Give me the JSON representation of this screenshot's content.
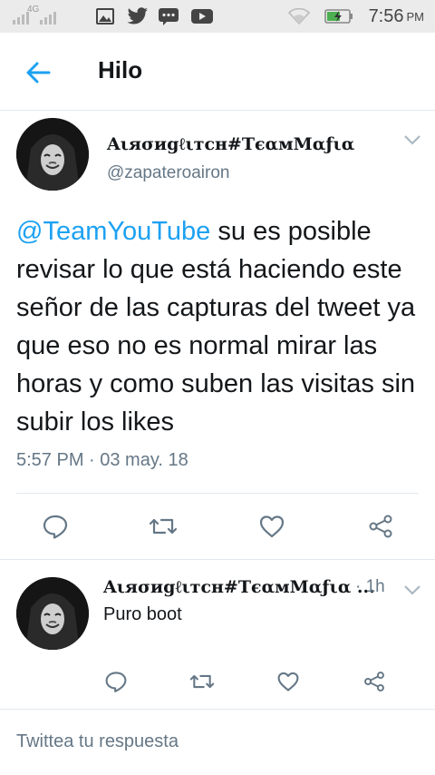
{
  "status_bar": {
    "network": "4G",
    "time": "7:56",
    "ampm": "PM"
  },
  "header": {
    "title": "Hilo",
    "back_icon": "arrow-left-icon"
  },
  "main_tweet": {
    "display_name": "Αιяσиgℓιтcн#TєαмMαƒια",
    "handle": "@zapateroairon",
    "mention": "@TeamYouTube",
    "text": " su es posible revisar lo que está haciendo este señor de las capturas del tweet ya que eso no es normal mirar las horas y como suben las visitas sin subir los likes",
    "timestamp": "5:57 PM · 03 may. 18"
  },
  "reply_tweet": {
    "display_name": "Αιяσиgℓιтcн#TєαмMαƒια ...",
    "meta": "· 1h",
    "text": "Puro boot"
  },
  "compose": {
    "placeholder": "Twittea tu respuesta"
  },
  "colors": {
    "accent": "#1da1f2",
    "secondary_text": "#657786",
    "icon_gray": "#657786",
    "divider": "#e1e8ed",
    "status_bar": "#ebebeb"
  }
}
